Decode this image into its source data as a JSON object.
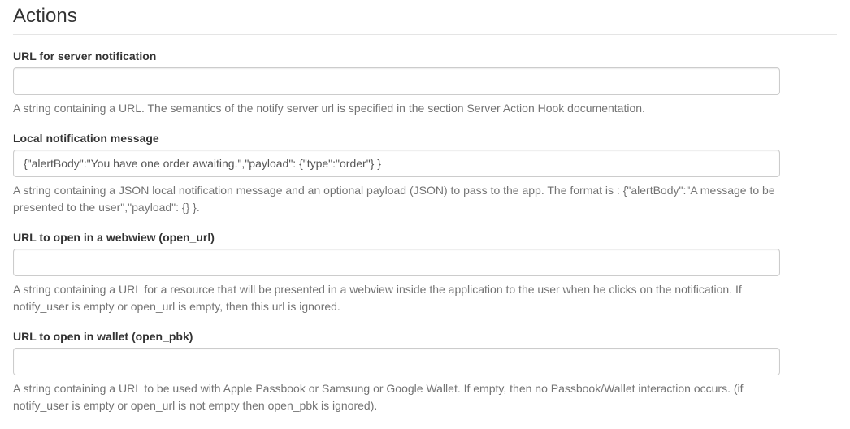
{
  "section": {
    "title": "Actions"
  },
  "fields": {
    "notify_server": {
      "label": "URL for server notification",
      "value": "",
      "help": "A string containing a URL. The semantics of the notify server url is specified in the section Server Action Hook documentation."
    },
    "notify_user": {
      "label": "Local notification message",
      "value": "{\"alertBody\":\"You have one order awaiting.\",\"payload\": {\"type\":\"order\"} }",
      "help": "A string containing a JSON local notification message and an optional payload (JSON) to pass to the app. The format is : {\"alertBody\":\"A message to be presented to the user\",\"payload\": {} }."
    },
    "open_url": {
      "label": "URL to open in a webwiew (open_url)",
      "value": "",
      "help": "A string containing a URL for a resource that will be presented in a webview inside the application to the user when he clicks on the notification. If notify_user is empty or open_url is empty, then this url is ignored."
    },
    "open_pbk": {
      "label": "URL to open in wallet (open_pbk)",
      "value": "",
      "help": "A string containing a URL to be used with Apple Passbook or Samsung or Google Wallet. If empty, then no Passbook/Wallet interaction occurs. (if notify_user is empty or open_url is not empty then open_pbk is ignored)."
    }
  }
}
